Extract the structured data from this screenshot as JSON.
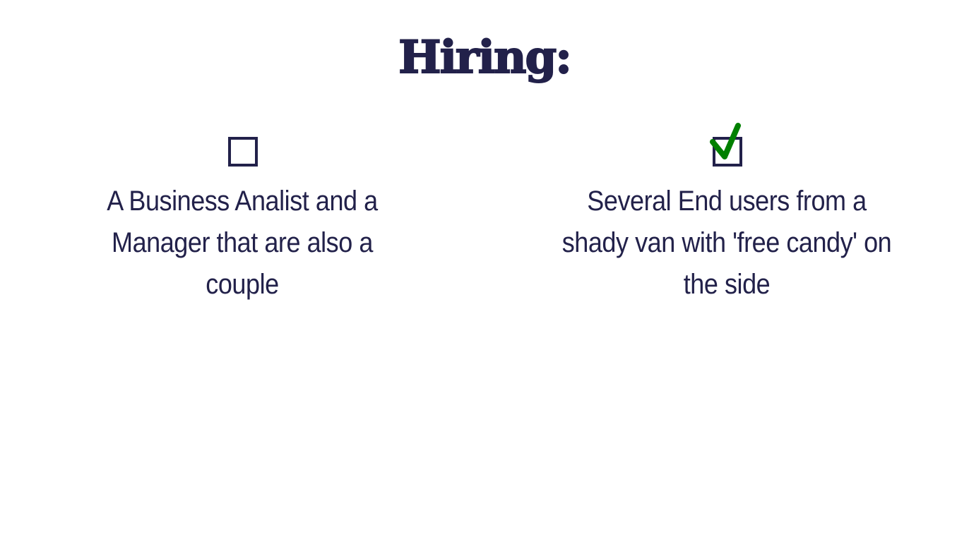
{
  "title": "Hiring:",
  "options": [
    {
      "label": "A Business Analist and a Manager that are also a couple",
      "checked": false
    },
    {
      "label": "Several End users from a shady van with 'free candy' on the side",
      "checked": true
    }
  ],
  "colors": {
    "text": "#22214a",
    "check": "#008000"
  }
}
